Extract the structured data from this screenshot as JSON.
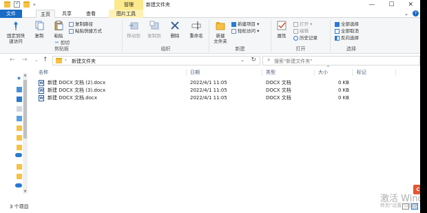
{
  "window": {
    "title": "新建文件夹",
    "manage_tab": "管理",
    "btn_min": "—",
    "btn_max": "☐",
    "btn_close": "✕"
  },
  "ribbon_tabs": {
    "file": "文件",
    "home": "主页",
    "share": "共享",
    "view": "查看",
    "picture_tools": "图片工具",
    "expand": "⌄",
    "help": "?"
  },
  "groups": {
    "clipboard": "剪贴板",
    "organize": "组织",
    "new": "新建",
    "open": "打开",
    "select": "选择"
  },
  "buttons": {
    "pin_quick_access": "固定到快\n速访问",
    "copy": "复制",
    "paste": "粘贴",
    "copy_path": "复制路径",
    "paste_shortcut": "粘贴快捷方式",
    "cut": "剪切",
    "move_to": "移动到",
    "copy_to": "复制到",
    "delete": "删除",
    "rename": "重命名",
    "new_folder": "新建\n文件夹",
    "new_item": "新建项目 ▾",
    "easy_access": "轻松访问 ▾",
    "properties": "属性",
    "open": "打开 ▾",
    "edit": "编辑",
    "history": "历史记录",
    "select_all": "全部选择",
    "select_none": "全部取消",
    "invert_selection": "反向选择"
  },
  "address": {
    "back": "←",
    "forward": "→",
    "dropdown": "⌄",
    "up": "↑",
    "chevron": "›",
    "path": "新建文件夹",
    "path_dropdown": "⌄",
    "refresh": "↻",
    "search_icon": "⌕",
    "search_placeholder": "搜索\"新建文件夹\""
  },
  "columns": {
    "name": "名称",
    "date": "日期",
    "type": "类型",
    "size": "大小",
    "tags": "标记",
    "sort_arrow": "^"
  },
  "files": [
    {
      "name": "新建 DOCX 文档 (2).docx",
      "date": "2022/4/1 11:05",
      "type": "DOCX 文档",
      "size": "0 KB"
    },
    {
      "name": "新建 DOCX 文档 (3).docx",
      "date": "2022/4/1 11:05",
      "type": "DOCX 文档",
      "size": "0 KB"
    },
    {
      "name": "新建 DOCX 文档.docx",
      "date": "2022/4/1 11:05",
      "type": "DOCX 文档",
      "size": "0 KB"
    }
  ],
  "status": {
    "item_count": "3 个项目"
  },
  "watermark": {
    "line1": "激活 Windo",
    "line2": "转到\"设置\"以激活"
  }
}
